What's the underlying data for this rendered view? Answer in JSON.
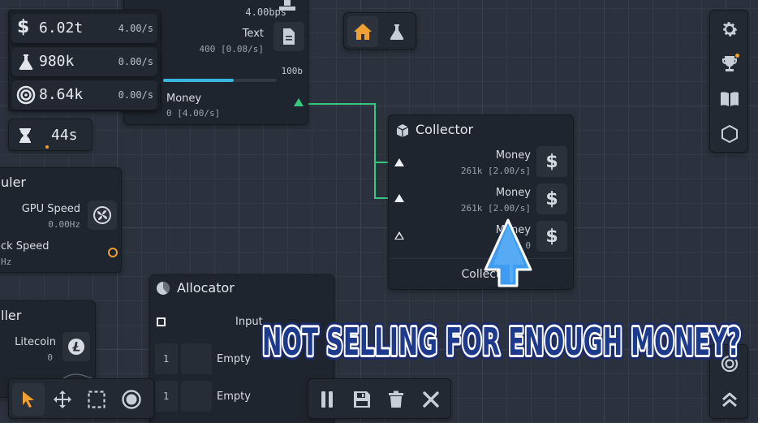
{
  "resources": [
    {
      "icon": "dollar-icon",
      "value": "6.02t",
      "rate": "4.00/s"
    },
    {
      "icon": "flask-icon",
      "value": "980k",
      "rate": "0.00/s"
    },
    {
      "icon": "target-icon",
      "value": "8.64k",
      "rate": "0.00/s"
    }
  ],
  "timer": {
    "icon": "hourglass-icon",
    "value": "44s"
  },
  "top_node": {
    "bps": "4.00bps",
    "text_label": "Text",
    "text_sub": "400 [0.08/s]",
    "size": "100b",
    "money_label": "Money",
    "money_sub": "0 [4.00/s]",
    "progress": 0.62
  },
  "center_toolbar": {
    "home_icon": "home-icon",
    "lab_icon": "flask-icon"
  },
  "collector": {
    "title": "Collector",
    "rows": [
      {
        "label": "Money",
        "sub": "261k [2.00/s]"
      },
      {
        "label": "Money",
        "sub": "261k [2.00/s]"
      },
      {
        "label": "Money",
        "sub": "0"
      }
    ],
    "button_label": "Collect"
  },
  "left_node_1": {
    "title": "uler",
    "gpu_label": "GPU Speed",
    "gpu_sub": "0.00Hz",
    "clock_label": "ck Speed",
    "clock_sub": "Hz"
  },
  "left_node_2": {
    "title": "ller",
    "litecoin_label": "Litecoin",
    "litecoin_sub": "0"
  },
  "allocator": {
    "title": "Allocator",
    "input_label": "Input",
    "rows": [
      {
        "count": "1",
        "label": "Empty"
      },
      {
        "count": "1",
        "label": "Empty"
      }
    ]
  },
  "banner": {
    "text": "NOT SELLING FOR ENOUGH MONEY?"
  },
  "colors": {
    "accent_orange": "#f0a030",
    "wire_green": "#35c97f",
    "progress_blue": "#38b6e0",
    "arrow_blue": "#3f9cf0"
  }
}
